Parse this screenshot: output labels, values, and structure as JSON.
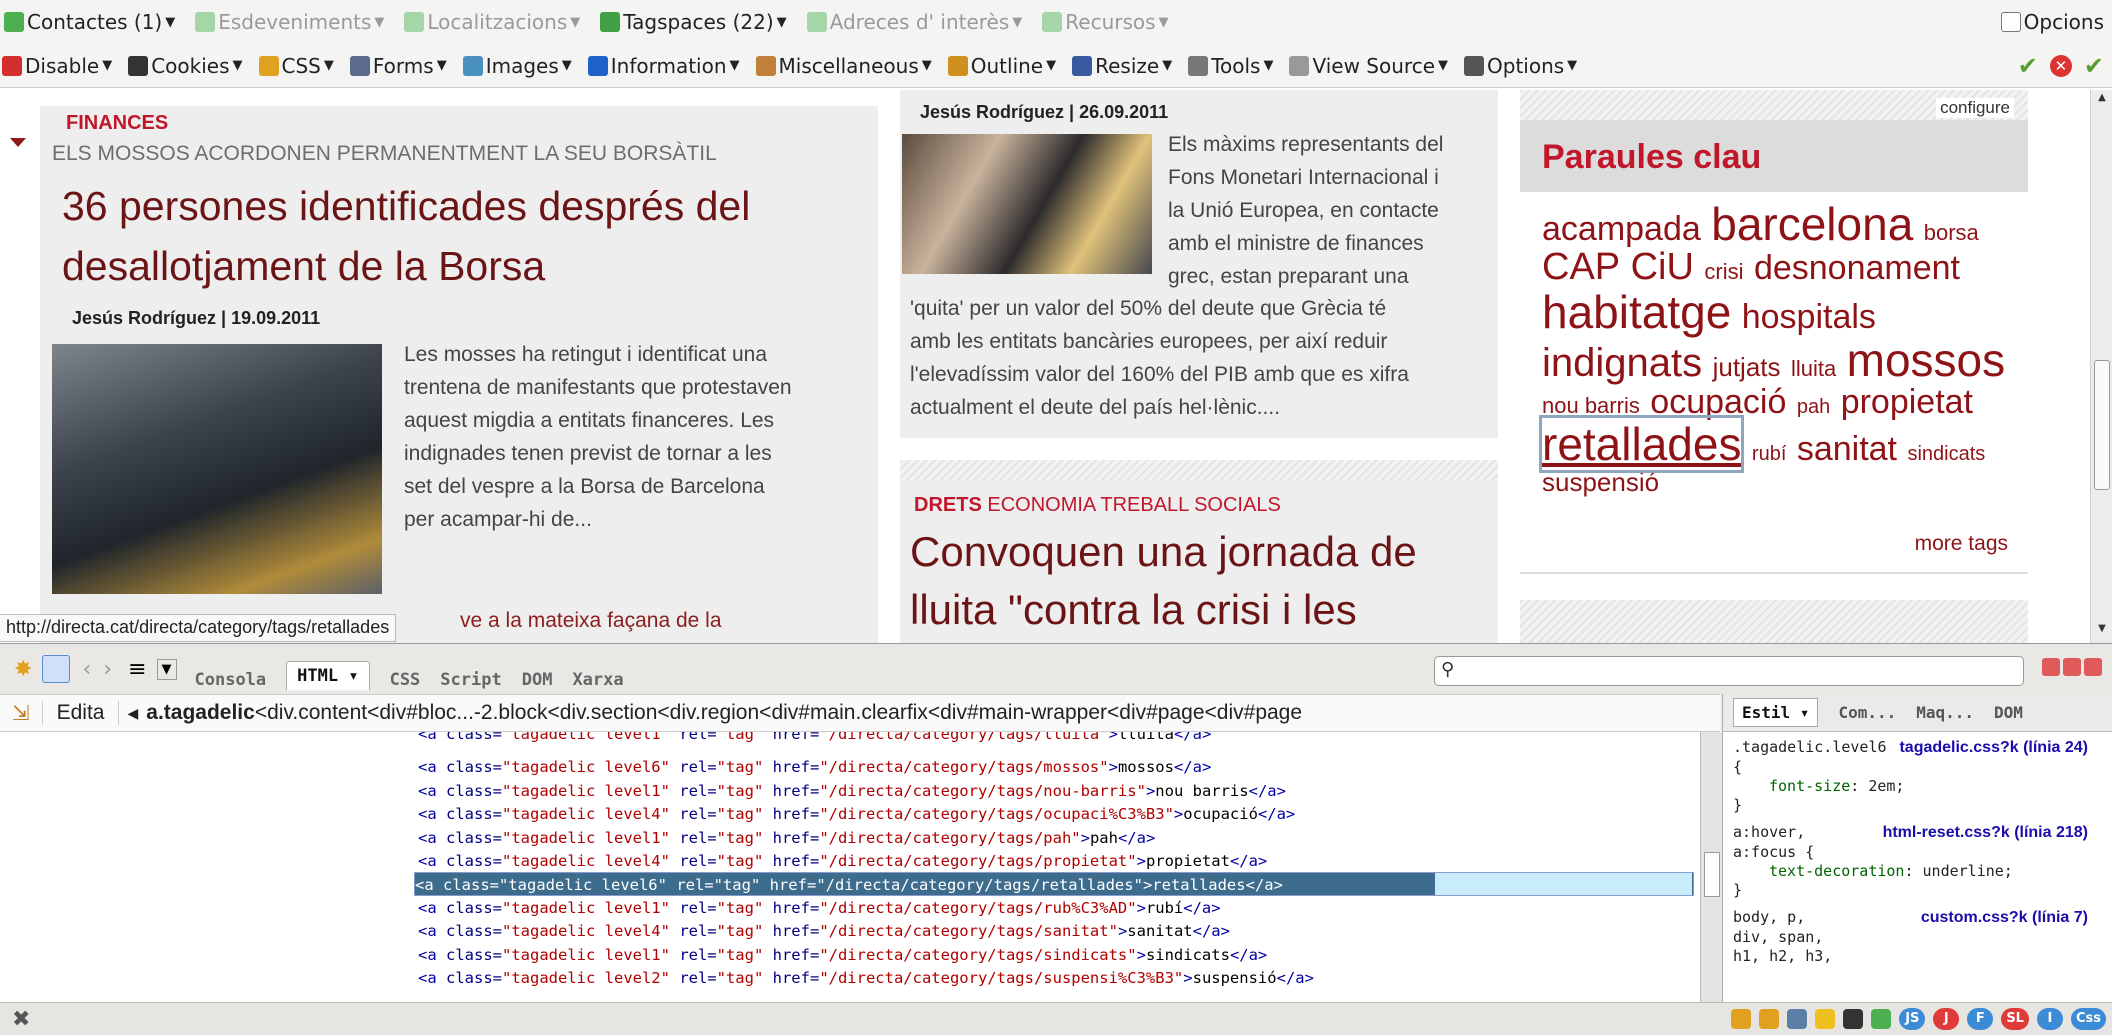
{
  "toolbar1": {
    "items": [
      {
        "label": "Contactes (1)",
        "color": "#4caf50",
        "dim": false
      },
      {
        "label": "Esdeveniments",
        "color": "#a5d6a7",
        "dim": true
      },
      {
        "label": "Localitzacions",
        "color": "#a5d6a7",
        "dim": true
      },
      {
        "label": "Tagspaces (22)",
        "color": "#43a047",
        "dim": false
      },
      {
        "label": "Adreces d' interès",
        "color": "#a5d6a7",
        "dim": true
      },
      {
        "label": "Recursos",
        "color": "#a5d6a7",
        "dim": true
      }
    ],
    "options_label": "Opcions"
  },
  "toolbar2": {
    "items": [
      {
        "label": "Disable",
        "color": "#d32f2f"
      },
      {
        "label": "Cookies",
        "color": "#333333"
      },
      {
        "label": "CSS",
        "color": "#e0a020"
      },
      {
        "label": "Forms",
        "color": "#5b6b8c"
      },
      {
        "label": "Images",
        "color": "#4a90c0"
      },
      {
        "label": "Information",
        "color": "#1e64c8"
      },
      {
        "label": "Miscellaneous",
        "color": "#c0803a"
      },
      {
        "label": "Outline",
        "color": "#d09020"
      },
      {
        "label": "Resize",
        "color": "#3a5aa0"
      },
      {
        "label": "Tools",
        "color": "#777777"
      },
      {
        "label": "View Source",
        "color": "#999999"
      },
      {
        "label": "Options",
        "color": "#555555"
      }
    ]
  },
  "article1": {
    "category": "FINANCES",
    "kicker": "ELS MOSSOS ACORDONEN PERMANENTMENT LA SEU BORSÀTIL",
    "title_line1": "36 persones identificades després del",
    "title_line2": "desallotjament de la Borsa",
    "byline": "Jesús Rodríguez | 19.09.2011",
    "body": [
      "Les mosses ha retingut i identificat una",
      "trentena de manifestants que protestaven",
      "aquest migdia a entitats financeres. Les",
      "indignades tenen previst de tornar a les",
      "set del vespre a la Borsa de Barcelona",
      "per acampar-hi de..."
    ],
    "related_partial": "ve a la mateixa façana de la"
  },
  "article2": {
    "byline": "Jesús Rodríguez | 26.09.2011",
    "body_side": [
      "Els màxims representants del",
      "Fons Monetari Internacional i",
      "la Unió Europea, en contacte",
      "amb el ministre de finances",
      "grec, estan preparant una"
    ],
    "body_full": [
      "'quita' per un valor del 50% del deute que Grècia té",
      "amb les entitats bancàries europees, per així reduir",
      "l'elevadíssim valor del 160% del PIB amb que es xifra",
      "actualment el deute del país hel·lènic...."
    ]
  },
  "article3": {
    "cat_bold": "DRETS",
    "cats": "ECONOMIA  TREBALL  SOCIALS",
    "title_line1": "Convoquen una jornada de",
    "title_line2": "lluita \"contra la crisi i les"
  },
  "tagcloud": {
    "configure": "configure",
    "title": "Paraules clau",
    "tags": [
      {
        "label": "acampada",
        "size": 34
      },
      {
        "label": "barcelona",
        "size": 46
      },
      {
        "label": "borsa",
        "size": 22
      },
      {
        "label": "CAP",
        "size": 38
      },
      {
        "label": "CiU",
        "size": 38
      },
      {
        "label": "crisi",
        "size": 22
      },
      {
        "label": "desnonament",
        "size": 34
      },
      {
        "label": "habitatge",
        "size": 46
      },
      {
        "label": "hospitals",
        "size": 34
      },
      {
        "label": "indignats",
        "size": 40
      },
      {
        "label": "jutjats",
        "size": 26
      },
      {
        "label": "lluita",
        "size": 22
      },
      {
        "label": "mossos",
        "size": 46
      },
      {
        "label": "nou barris",
        "size": 22
      },
      {
        "label": "ocupació",
        "size": 34
      },
      {
        "label": "pah",
        "size": 20
      },
      {
        "label": "propietat",
        "size": 34
      },
      {
        "label": "retallades",
        "size": 46
      },
      {
        "label": "rubí",
        "size": 20
      },
      {
        "label": "sanitat",
        "size": 34
      },
      {
        "label": "sindicats",
        "size": 20
      },
      {
        "label": "suspensió",
        "size": 26
      }
    ],
    "more": "more tags"
  },
  "status_url": "http://directa.cat/directa/category/tags/retallades",
  "firebug": {
    "tabs": [
      "Consola",
      "HTML",
      "CSS",
      "Script",
      "DOM",
      "Xarxa"
    ],
    "active_tab": "HTML",
    "edit_label": "Edita",
    "breadcrumb": [
      "a.tagadelic",
      "div.content",
      "div#bloc...-2.block",
      "div.section",
      "div.region",
      "div#main.clearfix",
      "div#main-wrapper",
      "div#page",
      "div#page"
    ],
    "code_lines": [
      {
        "level": "level1",
        "href": "/directa/category/tags/lluita",
        "text": "lluita",
        "partial": true
      },
      {
        "level": "level6",
        "href": "/directa/category/tags/mossos",
        "text": "mossos"
      },
      {
        "level": "level1",
        "href": "/directa/category/tags/nou-barris",
        "text": "nou barris"
      },
      {
        "level": "level4",
        "href": "/directa/category/tags/ocupaci%C3%B3",
        "text": "ocupació"
      },
      {
        "level": "level1",
        "href": "/directa/category/tags/pah",
        "text": "pah"
      },
      {
        "level": "level4",
        "href": "/directa/category/tags/propietat",
        "text": "propietat"
      },
      {
        "level": "level6",
        "href": "/directa/category/tags/retallades",
        "text": "retallades",
        "selected": true
      },
      {
        "level": "level1",
        "href": "/directa/category/tags/rub%C3%AD",
        "text": "rubí"
      },
      {
        "level": "level4",
        "href": "/directa/category/tags/sanitat",
        "text": "sanitat"
      },
      {
        "level": "level1",
        "href": "/directa/category/tags/sindicats",
        "text": "sindicats"
      },
      {
        "level": "level2",
        "href": "/directa/category/tags/suspensi%C3%B3",
        "text": "suspensió"
      }
    ],
    "side_tabs": [
      "Estil",
      "Com...",
      "Maq...",
      "DOM"
    ],
    "css_rules": {
      "r1_selector": ".tagadelic.level6",
      "r1_source": "tagadelic.css?k (línia 24)",
      "r1_prop": "font-size",
      "r1_val": "2em;",
      "r2_selector1": "a:hover,",
      "r2_selector2": "a:focus {",
      "r2_source": "html-reset.css?k (línia 218)",
      "r2_prop": "text-decoration",
      "r2_val": "underline;",
      "r3_selector1": "body, p,",
      "r3_selector2": "div, span,",
      "r3_selector3": "h1, h2, h3,",
      "r3_source": "custom.css?k (línia 7)"
    },
    "status_icons": [
      {
        "label": "JS",
        "color": "#3b8bd6"
      },
      {
        "label": "J",
        "color": "#e03a3a"
      },
      {
        "label": "F",
        "color": "#3b8bd6"
      },
      {
        "label": "SL",
        "color": "#e03a3a"
      },
      {
        "label": "I",
        "color": "#3b8bd6"
      },
      {
        "label": "Css",
        "color": "#3b8bd6"
      }
    ]
  }
}
